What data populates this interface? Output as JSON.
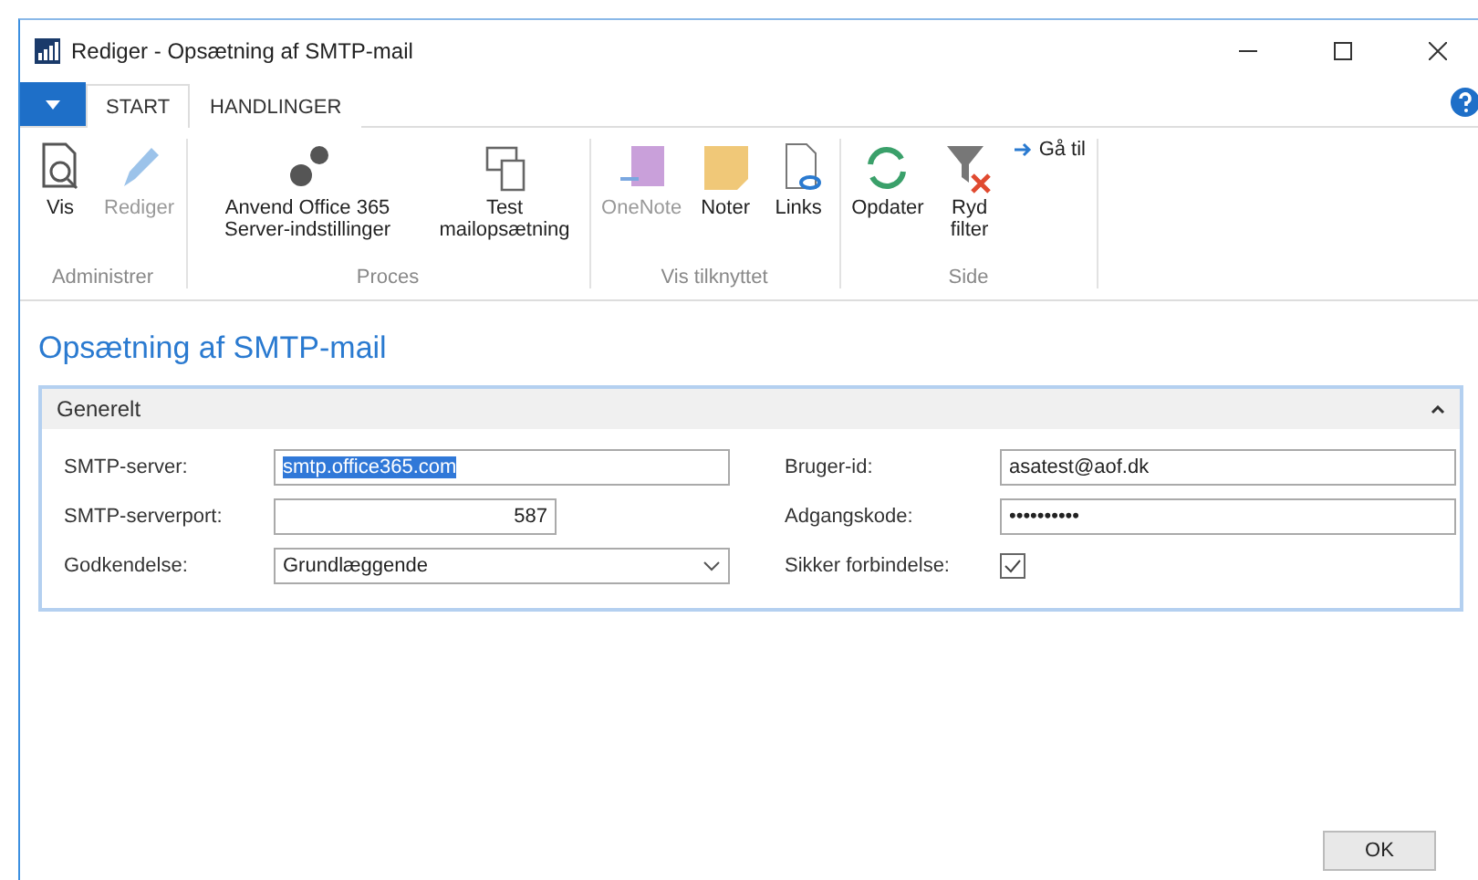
{
  "window": {
    "title": "Rediger - Opsætning af SMTP-mail"
  },
  "tabs": [
    {
      "label": "START",
      "selected": true
    },
    {
      "label": "HANDLINGER",
      "selected": false
    }
  ],
  "ribbon_groups": [
    {
      "label": "Administrer",
      "items": [
        {
          "label": "Vis",
          "disabled": false
        },
        {
          "label": "Rediger",
          "disabled": true
        }
      ]
    },
    {
      "label": "Proces",
      "items": [
        {
          "label": "Anvend Office 365 Server-indstillinger",
          "disabled": false
        },
        {
          "label": "Test mailopsætning",
          "disabled": false
        }
      ]
    },
    {
      "label": "Vis tilknyttet",
      "items": [
        {
          "label": "OneNote",
          "disabled": true
        },
        {
          "label": "Noter",
          "disabled": false
        },
        {
          "label": "Links",
          "disabled": false
        }
      ]
    },
    {
      "label": "Side",
      "items": [
        {
          "label": "Opdater",
          "disabled": false
        },
        {
          "label": "Ryd filter",
          "disabled": false
        }
      ],
      "link": "Gå til"
    }
  ],
  "page_title": "Opsætning af SMTP-mail",
  "section": {
    "title": "Generelt",
    "expanded": true
  },
  "left_fields": [
    {
      "kind": "text",
      "label": "SMTP-server:",
      "value": "smtp.office365.com",
      "selected": true
    },
    {
      "kind": "number",
      "label": "SMTP-serverport:",
      "value": "587"
    },
    {
      "kind": "select",
      "label": "Godkendelse:",
      "value": "Grundlæggende"
    }
  ],
  "right_fields": [
    {
      "kind": "text",
      "label": "Bruger-id:",
      "value": "asatest@aof.dk",
      "selected": false
    },
    {
      "kind": "password",
      "label": "Adgangskode:",
      "value": "••••••••••"
    },
    {
      "kind": "checkbox",
      "label": "Sikker forbindelse:",
      "checked": true
    }
  ],
  "ok_button": "OK"
}
